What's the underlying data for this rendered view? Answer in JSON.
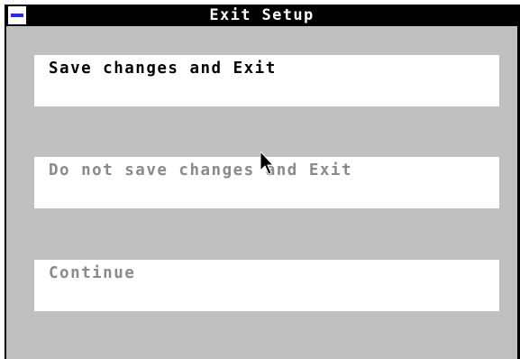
{
  "window": {
    "title": "Exit Setup"
  },
  "options": [
    {
      "label": "Save changes and Exit",
      "selected": true
    },
    {
      "label": "Do not save changes and Exit",
      "selected": false
    },
    {
      "label": "Continue",
      "selected": false
    }
  ],
  "colors": {
    "window_bg": "#c0c0c0",
    "titlebar_bg": "#000000",
    "title_text": "#ffffff",
    "sysmenu_accent": "#2727ff",
    "option_bg": "#ffffff",
    "selected_text": "#000000",
    "unselected_text": "#8a8a8a"
  }
}
